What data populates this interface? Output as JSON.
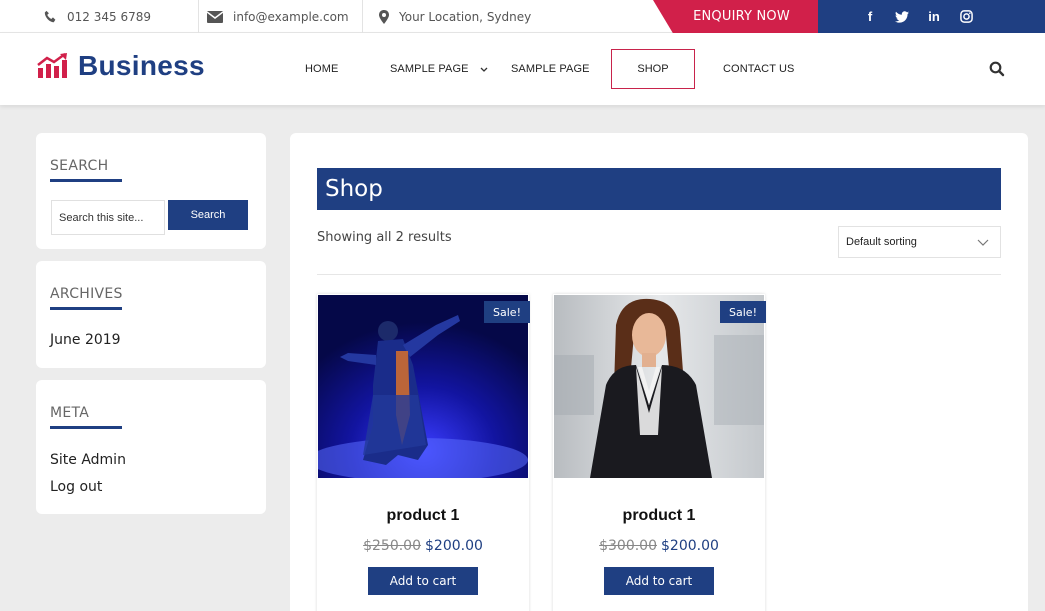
{
  "topbar": {
    "phone": "012 345 6789",
    "email": "info@example.com",
    "location": "Your Location, Sydney",
    "enquiry_label": "ENQUIRY NOW",
    "social_icons": [
      "facebook-icon",
      "twitter-icon",
      "linkedin-icon",
      "instagram-icon"
    ]
  },
  "header": {
    "logo_text": "Business",
    "nav": [
      "HOME",
      "SAMPLE PAGE",
      "SAMPLE PAGE",
      "SHOP",
      "CONTACT US"
    ],
    "active": "SHOP"
  },
  "sidebar": {
    "search": {
      "title": "SEARCH",
      "placeholder": "Search this site...",
      "button": "Search"
    },
    "archives": {
      "title": "ARCHIVES",
      "items": [
        "June 2019"
      ]
    },
    "meta": {
      "title": "META",
      "items": [
        "Site Admin",
        "Log out"
      ]
    }
  },
  "main": {
    "title": "Shop",
    "results": "Showing all 2 results",
    "sorting": "Default sorting",
    "products": [
      {
        "badge": "Sale!",
        "name": "product 1",
        "old_price": "$250.00",
        "new_price": "$200.00",
        "button": "Add to cart"
      },
      {
        "badge": "Sale!",
        "name": "product 1",
        "old_price": "$300.00",
        "new_price": "$200.00",
        "button": "Add to cart"
      }
    ]
  },
  "colors": {
    "brand_blue": "#1f3f82",
    "accent_red": "#d1204a",
    "page_bg": "#ececec"
  }
}
